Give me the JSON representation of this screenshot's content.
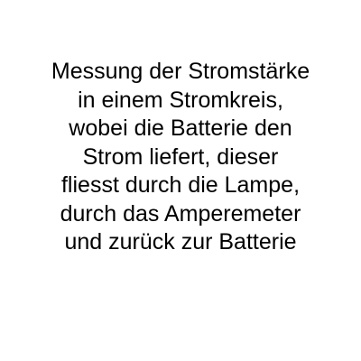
{
  "document": {
    "lines": [
      "Messung der Stromstärke",
      "in einem Stromkreis,",
      "wobei die Batterie den",
      "Strom liefert, dieser",
      "fliesst durch die Lampe,",
      "durch das Amperemeter",
      "und zurück zur Batterie"
    ]
  },
  "colors": {
    "background": "#ffffff",
    "text": "#000000"
  }
}
